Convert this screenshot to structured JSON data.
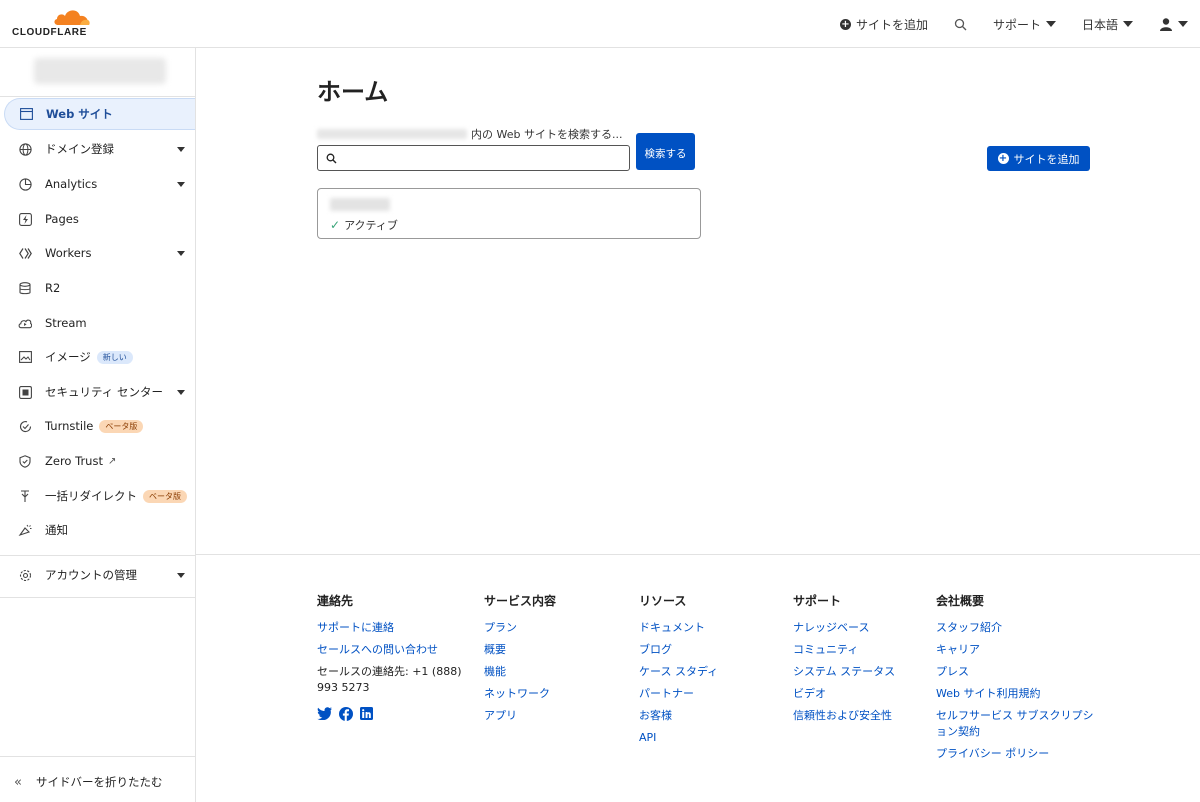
{
  "brand": {
    "logo_text": "CLOUDFLARE",
    "accent": "#f48120",
    "primary": "#0051c3"
  },
  "topbar": {
    "add_site": "サイトを追加",
    "support": "サポート",
    "language": "日本語"
  },
  "sidebar": {
    "items": [
      {
        "label": "Web サイト",
        "icon": "browser-window-icon"
      },
      {
        "label": "ドメイン登録",
        "icon": "globe-icon"
      },
      {
        "label": "Analytics",
        "icon": "pie-chart-icon"
      },
      {
        "label": "Pages",
        "icon": "lightning-icon"
      },
      {
        "label": "Workers",
        "icon": "code-diamond-icon"
      },
      {
        "label": "R2",
        "icon": "database-icon"
      },
      {
        "label": "Stream",
        "icon": "cloud-play-icon"
      },
      {
        "label": "イメージ",
        "icon": "image-icon",
        "badge": "新しい"
      },
      {
        "label": "セキュリティ センター",
        "icon": "shield-square-icon"
      },
      {
        "label": "Turnstile",
        "icon": "turnstile-icon",
        "badge": "ベータ版"
      },
      {
        "label": "Zero Trust",
        "icon": "shield-check-icon"
      },
      {
        "label": "一括リダイレクト",
        "icon": "redirect-icon",
        "badge": "ベータ版"
      },
      {
        "label": "通知",
        "icon": "bell-icon"
      },
      {
        "label": "アカウントの管理",
        "icon": "gear-icon"
      }
    ],
    "collapse": "サイドバーを折りたたむ"
  },
  "main": {
    "title": "ホーム",
    "search_label": "内の Web サイトを検索する...",
    "search_value": "",
    "search_button": "検索する",
    "add_site_button": "サイトを追加",
    "sites": [
      {
        "status": "アクティブ"
      }
    ]
  },
  "footer": {
    "contact": {
      "heading": "連絡先",
      "links": [
        "サポートに連絡",
        "セールスへの問い合わせ"
      ],
      "sales_phone": "セールスの連絡先: +1 (888) 993 5273"
    },
    "services": {
      "heading": "サービス内容",
      "links": [
        "プラン",
        "概要",
        "機能",
        "ネットワーク",
        "アプリ"
      ]
    },
    "resources": {
      "heading": "リソース",
      "links": [
        "ドキュメント",
        "ブログ",
        "ケース スタディ",
        "パートナー",
        "お客様",
        "API"
      ]
    },
    "support": {
      "heading": "サポート",
      "links": [
        "ナレッジベース",
        "コミュニティ",
        "システム ステータス",
        "ビデオ",
        "信頼性および安全性"
      ]
    },
    "company": {
      "heading": "会社概要",
      "links": [
        "スタッフ紹介",
        "キャリア",
        "プレス",
        "Web サイト利用規約",
        "セルフサービス サブスクリプション契約",
        "プライバシー ポリシー"
      ]
    }
  }
}
